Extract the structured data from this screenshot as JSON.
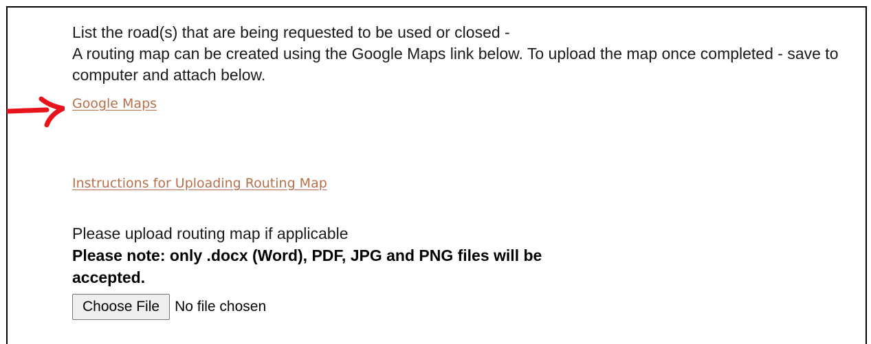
{
  "form": {
    "intro_line1": "List the road(s) that are being requested to be used or closed -",
    "intro_line2": "A routing map can be created using the Google Maps link below. To upload the map once completed - save to computer and attach below.",
    "google_maps_link": "Google Maps",
    "instructions_link": "Instructions for Uploading Routing Map",
    "upload_label": "Please upload routing map if applicable",
    "upload_note": "Please note: only .docx (Word), PDF, JPG and PNG files will be accepted.",
    "choose_file_button": "Choose File",
    "file_status": "No file chosen"
  },
  "colors": {
    "link": "#b5704a",
    "annotation_arrow": "#e8141b",
    "border": "#000000"
  },
  "icons": {
    "annotation": "red-arrow-icon"
  }
}
